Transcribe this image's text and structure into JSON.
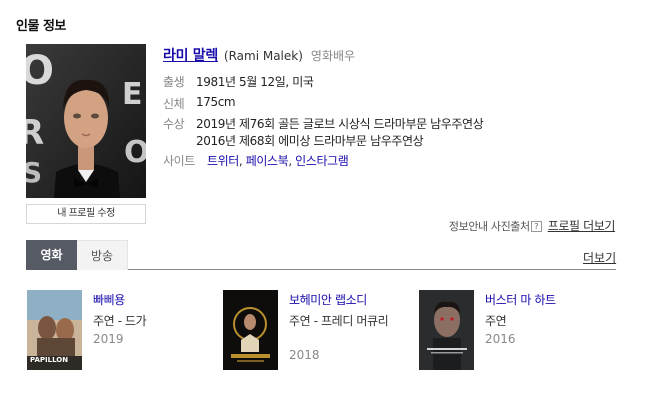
{
  "section_title": "인물 정보",
  "profile": {
    "photo_icon": "person-portrait-photo",
    "edit_label": "내 프로필 수정",
    "name_ko": "라미 말렉",
    "name_en": "(Rami Malek)",
    "job": "영화배우",
    "rows": {
      "birth": {
        "label": "출생",
        "value": "1981년 5월 12일, 미국"
      },
      "body": {
        "label": "신체",
        "value": "175cm"
      },
      "awards": {
        "label": "수상",
        "values": [
          "2019년 제76회 골든 글로브 시상식 드라마부문 남우주연상",
          "2016년 제68회 에미상 드라마부문 남우주연상"
        ]
      },
      "sites": {
        "label": "사이트",
        "links": [
          "트위터",
          "페이스북",
          "인스타그램"
        ],
        "separator": ","
      }
    },
    "source_label": "정보안내 사진출처",
    "help_symbol": "?",
    "more_profile": "프로필 더보기"
  },
  "tabs": {
    "items": [
      "영화",
      "방송"
    ],
    "active": "영화",
    "more": "더보기"
  },
  "films": [
    {
      "title": "빠삐용",
      "role": "주연 - 드가",
      "year": "2019",
      "poster_icon": "papillon-poster",
      "poster_text": "PAPILLON"
    },
    {
      "title": "보헤미안 랩소디",
      "role": "주연 - 프레디 머큐리",
      "year": "2018",
      "poster_icon": "bohemian-rhapsody-poster",
      "poster_text": ""
    },
    {
      "title": "버스터 마 하트",
      "role": "주연",
      "year": "2016",
      "poster_icon": "buster-mal-heart-poster",
      "poster_text": ""
    }
  ],
  "colors": {
    "link": "#1a0dab",
    "tab_active_bg": "#555a65",
    "tab_inactive_bg": "#f3f3f3"
  }
}
